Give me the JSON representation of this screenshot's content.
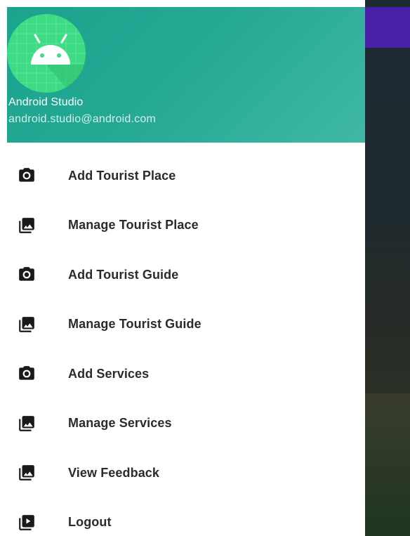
{
  "header": {
    "name": "Android Studio",
    "email": "android.studio@android.com"
  },
  "colors": {
    "header_bg": "#1aa38d",
    "toolbar_bg": "#4a1fa8",
    "icon": "#1a1a1a",
    "label": "#2b2b2b"
  },
  "menu": {
    "items": [
      {
        "label": "Add Tourist Place",
        "icon": "camera-icon"
      },
      {
        "label": "Manage Tourist Place",
        "icon": "gallery-icon"
      },
      {
        "label": "Add Tourist Guide",
        "icon": "camera-icon"
      },
      {
        "label": "Manage Tourist Guide",
        "icon": "gallery-icon"
      },
      {
        "label": "Add Services",
        "icon": "camera-icon"
      },
      {
        "label": "Manage Services",
        "icon": "gallery-icon"
      },
      {
        "label": "View Feedback",
        "icon": "gallery-icon"
      },
      {
        "label": "Logout",
        "icon": "slideshow-icon"
      }
    ]
  }
}
